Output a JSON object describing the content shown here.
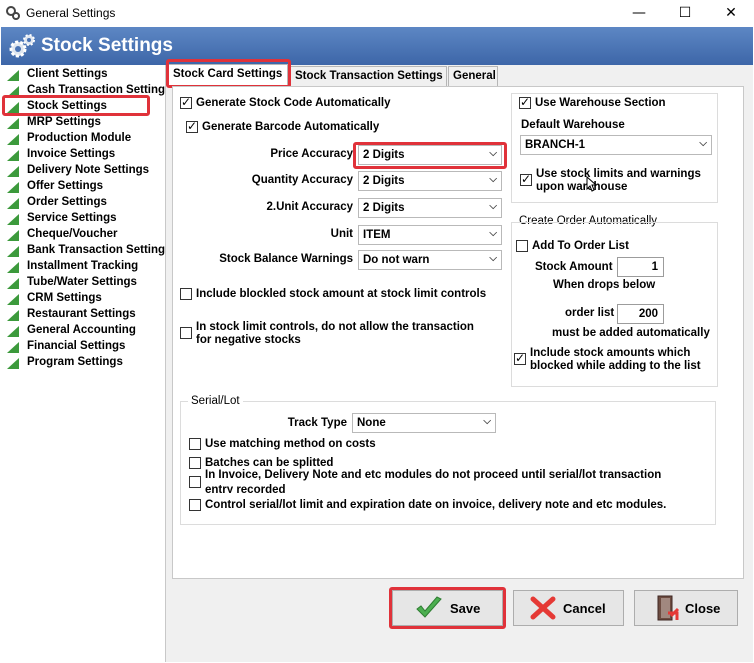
{
  "window": {
    "title": "General Settings",
    "minimize": "—",
    "maximize": "☐",
    "close": "✕"
  },
  "header": {
    "title": "Stock Settings"
  },
  "sidebar": {
    "items": [
      {
        "label": "Client Settings"
      },
      {
        "label": "Cash Transaction Settings"
      },
      {
        "label": "Stock Settings"
      },
      {
        "label": "MRP Settings"
      },
      {
        "label": "Production Module"
      },
      {
        "label": "Invoice Settings"
      },
      {
        "label": "Delivery Note Settings"
      },
      {
        "label": "Offer Settings"
      },
      {
        "label": "Order Settings"
      },
      {
        "label": "Service Settings"
      },
      {
        "label": "Cheque/Voucher"
      },
      {
        "label": "Bank Transaction Settings"
      },
      {
        "label": "Installment Tracking"
      },
      {
        "label": "Tube/Water Settings"
      },
      {
        "label": "CRM Settings"
      },
      {
        "label": "Restaurant Settings"
      },
      {
        "label": "General Accounting"
      },
      {
        "label": "Financial Settings"
      },
      {
        "label": "Program Settings"
      }
    ]
  },
  "tabs": [
    {
      "label": "Stock Card Settings"
    },
    {
      "label": "Stock Transaction Settings"
    },
    {
      "label": "General"
    }
  ],
  "left": {
    "gen_stock_code": "Generate Stock Code Automatically",
    "gen_barcode": "Generate Barcode Automatically",
    "price_accuracy_label": "Price Accuracy",
    "price_accuracy_value": "2 Digits",
    "quantity_accuracy_label": "Quantity Accuracy",
    "quantity_accuracy_value": "2 Digits",
    "unit2_accuracy_label": "2.Unit Accuracy",
    "unit2_accuracy_value": "2 Digits",
    "unit_label": "Unit",
    "unit_value": "ITEM",
    "balance_label": "Stock Balance Warnings",
    "balance_value": "Do not warn",
    "include_blocked": "Include blockled stock amount at stock limit controls",
    "no_negative_1": "In stock limit controls, do not allow the transaction",
    "no_negative_2": "for negative stocks"
  },
  "warehouse": {
    "use_section": "Use Warehouse Section",
    "default_label": "Default Warehouse",
    "default_value": "BRANCH-1",
    "use_limits_1": "Use stock limits and warnings",
    "use_limits_2": "upon warehouse"
  },
  "order": {
    "title": "Create Order Automatically",
    "add_to_list": "Add To Order List",
    "stock_amount_label": "Stock Amount",
    "stock_amount_value": "1",
    "when_drops": "When drops below",
    "order_list_label": "order list",
    "order_list_value": "200",
    "must_add": "must be added automatically",
    "include_blocked_1": "Include stock amounts which",
    "include_blocked_2": "blocked while adding to the list"
  },
  "serial": {
    "title": "Serial/Lot",
    "track_label": "Track Type",
    "track_value": "None",
    "matching": "Use matching method on costs",
    "batches": "Batches can be splitted",
    "invoice_1": "In Invoice, Delivery Note and etc modules do not proceed until serial/lot transaction",
    "invoice_2": "entry recorded",
    "control": "Control serial/lot limit and expiration date on invoice, delivery note and etc modules."
  },
  "buttons": {
    "save": "Save",
    "cancel": "Cancel",
    "close": "Close"
  },
  "colors": {
    "header": "#4a74b6",
    "highlight": "#e0323a",
    "tree_icon": "#3c9a3c"
  }
}
